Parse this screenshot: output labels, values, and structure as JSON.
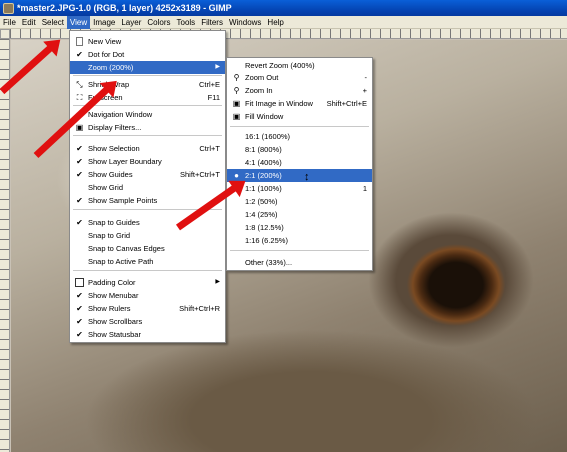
{
  "window": {
    "title": "*master2.JPG-1.0 (RGB, 1 layer) 4252x3189 - GIMP"
  },
  "menubar": [
    "File",
    "Edit",
    "Select",
    "View",
    "Image",
    "Layer",
    "Colors",
    "Tools",
    "Filters",
    "Windows",
    "Help"
  ],
  "view_menu": {
    "new_view": "New View",
    "dot_for_dot": "Dot for Dot",
    "zoom": "Zoom (200%)",
    "shrink_wrap": "Shrink Wrap",
    "shrink_wrap_acc": "Ctrl+E",
    "fullscreen": "Fullscreen",
    "fullscreen_acc": "F11",
    "navigation_window": "Navigation Window",
    "display_filters": "Display Filters...",
    "show_selection": "Show Selection",
    "show_selection_acc": "Ctrl+T",
    "show_layer_boundary": "Show Layer Boundary",
    "show_guides": "Show Guides",
    "show_guides_acc": "Shift+Ctrl+T",
    "show_grid": "Show Grid",
    "show_sample_points": "Show Sample Points",
    "snap_to_guides": "Snap to Guides",
    "snap_to_grid": "Snap to Grid",
    "snap_to_canvas_edges": "Snap to Canvas Edges",
    "snap_to_active_path": "Snap to Active Path",
    "padding_color": "Padding Color",
    "show_menubar": "Show Menubar",
    "show_rulers": "Show Rulers",
    "show_rulers_acc": "Shift+Ctrl+R",
    "show_scrollbars": "Show Scrollbars",
    "show_statusbar": "Show Statusbar"
  },
  "zoom_menu": {
    "revert_zoom": "Revert Zoom (400%)",
    "zoom_out": "Zoom Out",
    "zoom_out_acc": "-",
    "zoom_in": "Zoom In",
    "zoom_in_acc": "+",
    "fit_image": "Fit Image in Window",
    "fit_image_acc": "Shift+Ctrl+E",
    "fill_window": "Fill Window",
    "levels": [
      {
        "label": "16:1  (1600%)",
        "acc": ""
      },
      {
        "label": "8:1  (800%)",
        "acc": ""
      },
      {
        "label": "4:1  (400%)",
        "acc": ""
      },
      {
        "label": "2:1  (200%)",
        "acc": ""
      },
      {
        "label": "1:1  (100%)",
        "acc": "1"
      },
      {
        "label": "1:2  (50%)",
        "acc": ""
      },
      {
        "label": "1:4  (25%)",
        "acc": ""
      },
      {
        "label": "1:8  (12.5%)",
        "acc": ""
      },
      {
        "label": "1:16  (6.25%)",
        "acc": ""
      }
    ],
    "other": "Other (33%)..."
  },
  "colors": {
    "highlight": "#316ac5",
    "arrow": "#e01010",
    "titlebar": "#0546b5"
  }
}
